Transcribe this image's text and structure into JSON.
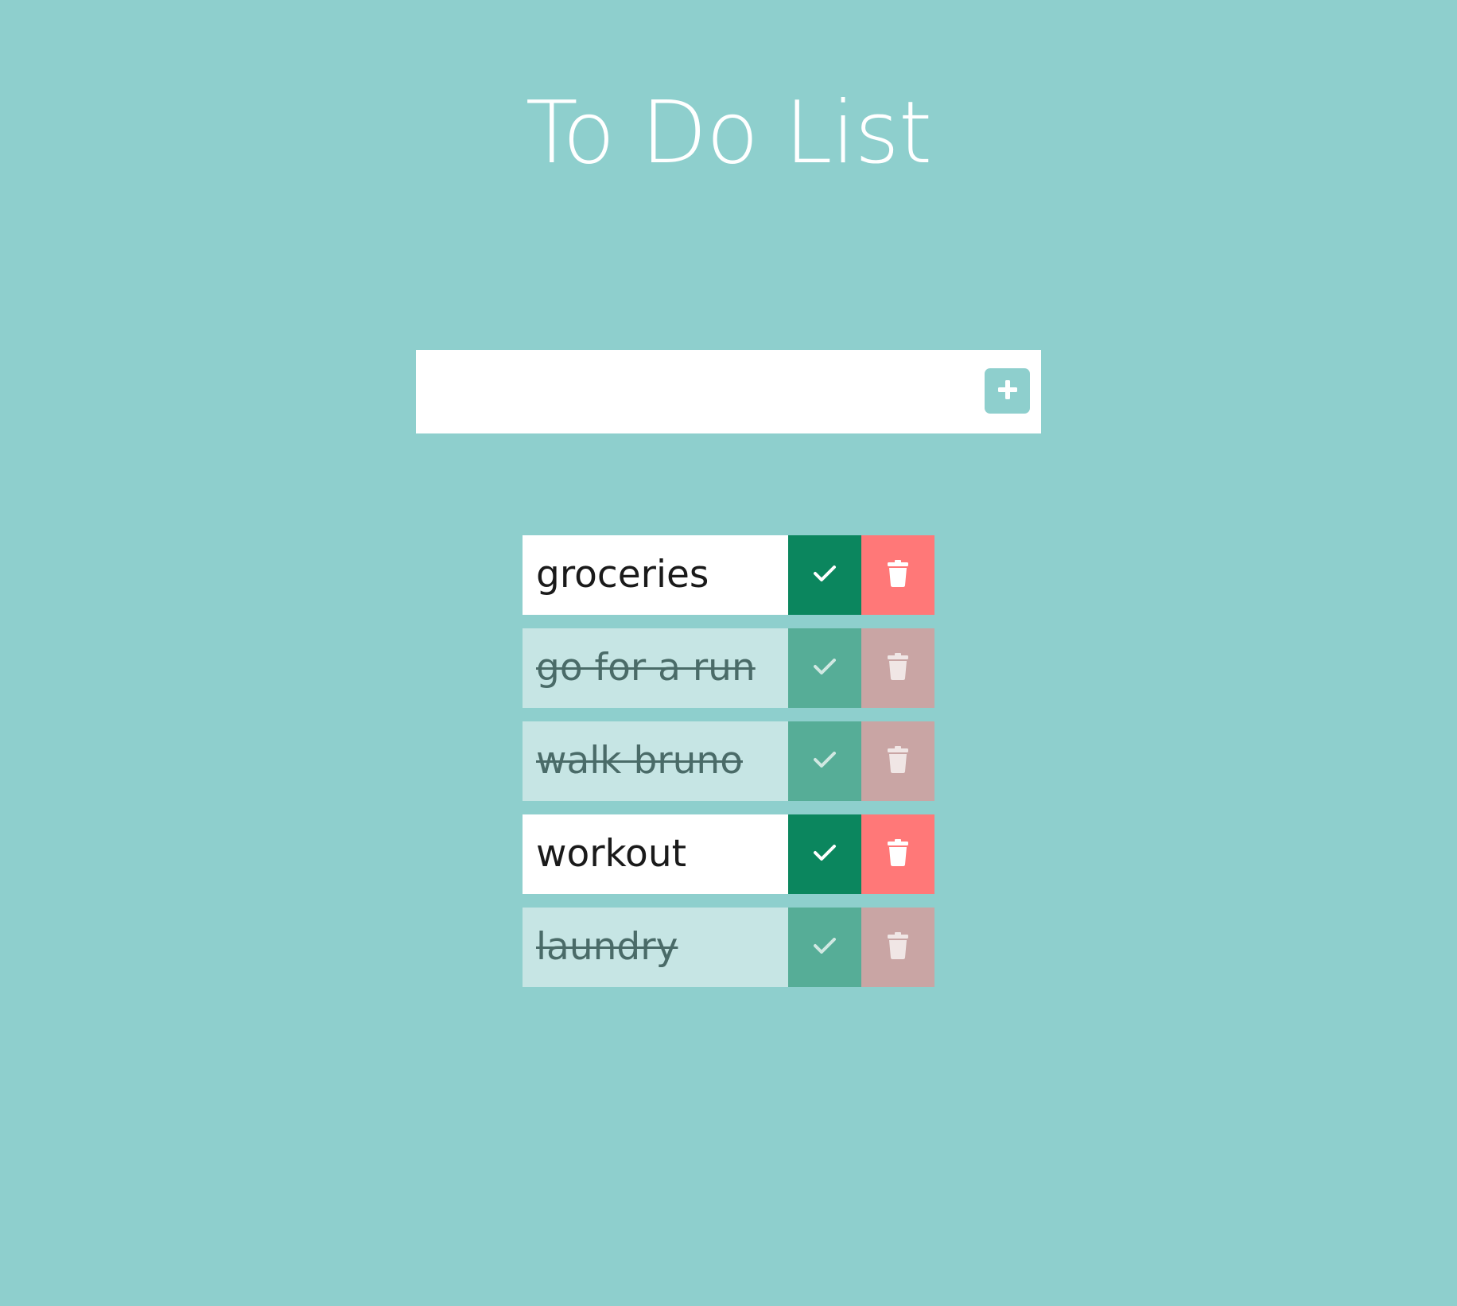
{
  "app": {
    "title": "To Do List"
  },
  "entry": {
    "value": "",
    "placeholder": "",
    "add_icon": "plus-icon"
  },
  "todos": [
    {
      "text": "groceries",
      "completed": false,
      "check_icon": "check-icon",
      "delete_icon": "trash-icon"
    },
    {
      "text": "go for a run",
      "completed": true,
      "check_icon": "check-icon",
      "delete_icon": "trash-icon"
    },
    {
      "text": "walk bruno",
      "completed": true,
      "check_icon": "check-icon",
      "delete_icon": "trash-icon"
    },
    {
      "text": "workout",
      "completed": false,
      "check_icon": "check-icon",
      "delete_icon": "trash-icon"
    },
    {
      "text": "laundry",
      "completed": true,
      "check_icon": "check-icon",
      "delete_icon": "trash-icon"
    }
  ],
  "colors": {
    "background": "#8ecfcd",
    "check": "#0b865e",
    "delete": "#ff7878",
    "check_done": "#56ad97",
    "delete_done": "#c9a5a4",
    "row_done": "#c6e5e4"
  }
}
